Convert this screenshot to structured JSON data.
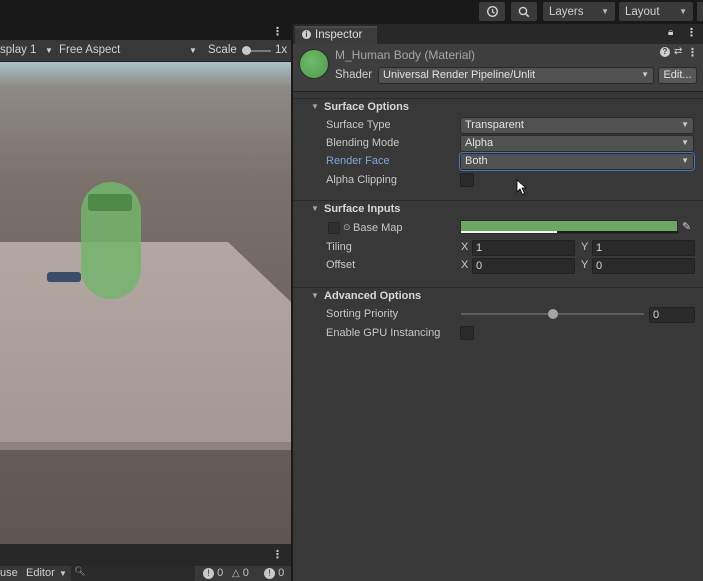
{
  "toolbar": {
    "layers_label": "Layers",
    "layout_label": "Layout"
  },
  "game_view": {
    "display_label": "splay 1",
    "aspect_label": "Free Aspect",
    "scale_label": "Scale",
    "scale_value": "1x"
  },
  "bottom_panel": {
    "use_label": "use",
    "editor_label": "Editor",
    "errors_count": "0",
    "warnings_count": "0",
    "info_count": "0"
  },
  "inspector": {
    "tab_label": "Inspector",
    "material_name": "M_Human Body (Material)",
    "shader_label": "Shader",
    "shader_value": "Universal Render Pipeline/Unlit",
    "edit_button": "Edit...",
    "material_color": "#5ca557",
    "surface_options": {
      "title": "Surface Options",
      "surface_type_label": "Surface Type",
      "surface_type_value": "Transparent",
      "blending_mode_label": "Blending Mode",
      "blending_mode_value": "Alpha",
      "render_face_label": "Render Face",
      "render_face_value": "Both",
      "alpha_clipping_label": "Alpha Clipping"
    },
    "surface_inputs": {
      "title": "Surface Inputs",
      "base_map_label": "Base Map",
      "base_map_color": "#6da863",
      "tiling_label": "Tiling",
      "tiling_x": "1",
      "tiling_y": "1",
      "offset_label": "Offset",
      "offset_x": "0",
      "offset_y": "0",
      "axis_x": "X",
      "axis_y": "Y"
    },
    "advanced_options": {
      "title": "Advanced Options",
      "sorting_priority_label": "Sorting Priority",
      "sorting_priority_value": "0",
      "gpu_instancing_label": "Enable GPU Instancing"
    }
  }
}
